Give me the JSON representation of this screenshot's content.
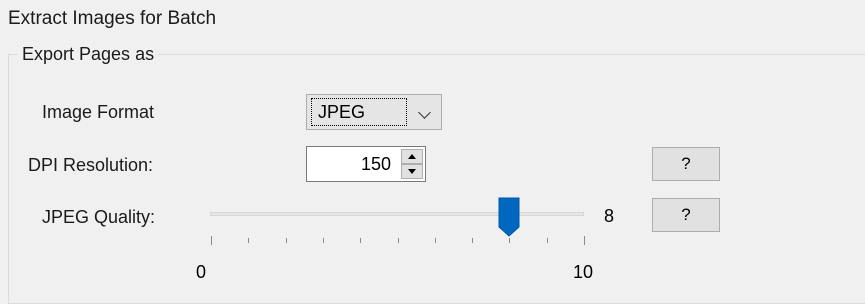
{
  "window": {
    "title": "Extract Images for Batch"
  },
  "export_group": {
    "legend": "Export Pages as",
    "image_format": {
      "label": "Image Format",
      "selected": "JPEG"
    },
    "dpi": {
      "label": "DPI Resolution:",
      "value": "150",
      "help_label": "?"
    },
    "jpeg_quality": {
      "label": "JPEG Quality:",
      "value": 8,
      "value_text": "8",
      "min": 0,
      "max": 10,
      "min_label": "0",
      "max_label": "10",
      "help_label": "?"
    }
  },
  "colors": {
    "slider_thumb": "#0067c0",
    "background": "#f0f0f0"
  }
}
